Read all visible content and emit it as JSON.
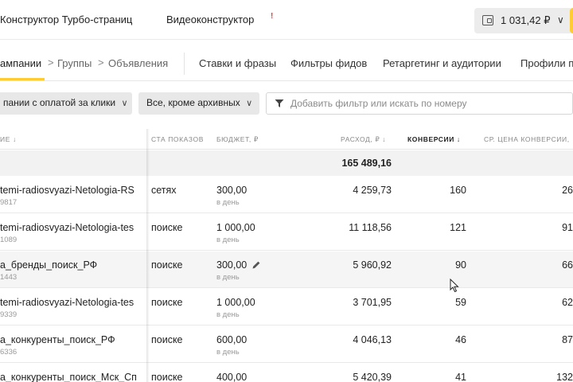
{
  "topbar": {
    "turbo_link": "Конструктор Турбо-страниц",
    "video_link": "Видеоконструктор",
    "new_marker": "!",
    "balance": "1 031,42 ₽",
    "balance_chevron": "∨"
  },
  "breadcrumbs": {
    "campaigns": "ампании",
    "groups": "Группы",
    "ads": "Объявления",
    "sep": ">"
  },
  "tabs": [
    "Ставки и фразы",
    "Фильтры фидов",
    "Ретаргетинг и аудитории",
    "Профили п"
  ],
  "filters": {
    "campaign_type": "пании с оплатой за клики",
    "status": "Все, кроме архивных",
    "search_placeholder": "Добавить фильтр или искать по номеру"
  },
  "columns": {
    "name": "ие ↓",
    "place": "ста показов",
    "budget": "Бюджет, ₽",
    "spend": "Расход, ₽ ↓",
    "conversions": "Конверсии ↓",
    "cpa": "Ср. цена конверсии,"
  },
  "totals": {
    "spend": "165 489,16"
  },
  "rows": [
    {
      "name": "temi-radiosvyazi-Netologia-RS",
      "id": "9817",
      "place": "сетях",
      "budget": "300,00",
      "budget_period": "в день",
      "spend": "4 259,73",
      "conversions": "160",
      "cpa": "26"
    },
    {
      "name": "temi-radiosvyazi-Netologia-tes",
      "id": "1089",
      "place": "поиске",
      "budget": "1 000,00",
      "budget_period": "в день",
      "spend": "11 118,56",
      "conversions": "121",
      "cpa": "91"
    },
    {
      "name": "а_бренды_поиск_РФ",
      "id": "1443",
      "place": "поиске",
      "budget": "300,00",
      "budget_period": "в день",
      "spend": "5 960,92",
      "conversions": "90",
      "cpa": "66"
    },
    {
      "name": "temi-radiosvyazi-Netologia-tes",
      "id": "9339",
      "place": "поиске",
      "budget": "1 000,00",
      "budget_period": "в день",
      "spend": "3 701,95",
      "conversions": "59",
      "cpa": "62"
    },
    {
      "name": "а_конкуренты_поиск_РФ",
      "id": "6336",
      "place": "поиске",
      "budget": "600,00",
      "budget_period": "в день",
      "spend": "4 046,13",
      "conversions": "46",
      "cpa": "87"
    },
    {
      "name": "а_конкуренты_поиск_Мск_Сп",
      "id": "",
      "place": "поиске",
      "budget": "400,00",
      "budget_period": "",
      "spend": "5 420,39",
      "conversions": "41",
      "cpa": "132"
    }
  ],
  "colors": {
    "accent": "#ffcc33",
    "muted_text": "#888888",
    "row_highlight": "#f5f5f5"
  }
}
